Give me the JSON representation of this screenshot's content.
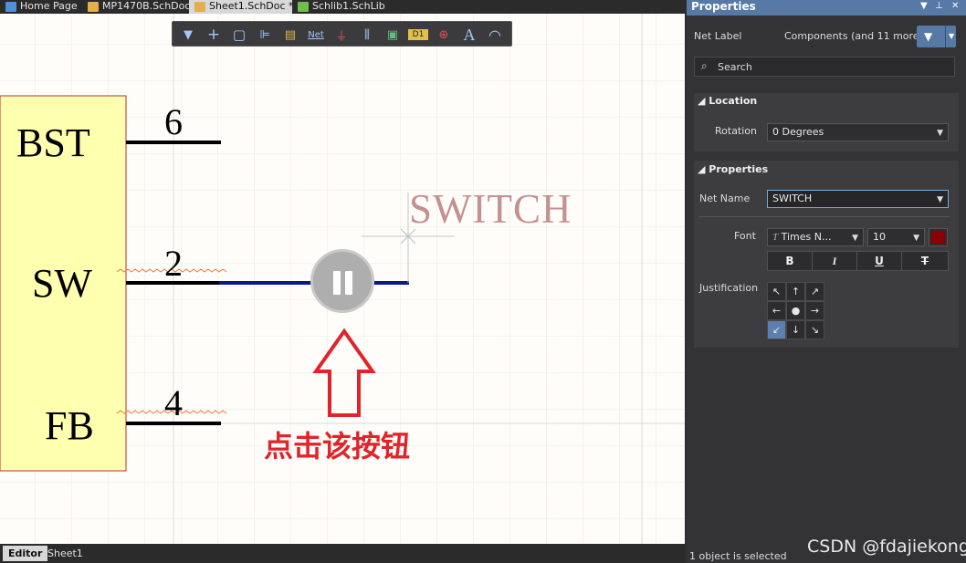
{
  "tabs": [
    {
      "label": "Home Page",
      "icon": "home-icon",
      "color": "#4f8fe0"
    },
    {
      "label": "MP1470B.SchDoc",
      "icon": "schematic-doc-icon",
      "color": "#e3b04a"
    },
    {
      "label": "Sheet1.SchDoc *",
      "icon": "schematic-doc-icon",
      "color": "#e3b04a"
    },
    {
      "label": "Schlib1.SchLib",
      "icon": "schlib-icon",
      "color": "#6fbf4a"
    }
  ],
  "toolbar": {
    "tools": [
      {
        "name": "filter-tool-icon",
        "glyph": "▼"
      },
      {
        "name": "crosshair-tool-icon",
        "glyph": "+"
      },
      {
        "name": "select-box-tool-icon",
        "glyph": "▢"
      },
      {
        "name": "align-tool-icon",
        "glyph": "⊫"
      },
      {
        "name": "component-tool-icon",
        "glyph": "▤"
      },
      {
        "name": "netlabel-tool-icon",
        "glyph": "Net"
      },
      {
        "name": "ground-tool-icon",
        "glyph": "⏚"
      },
      {
        "name": "bus-tool-icon",
        "glyph": "⫼"
      },
      {
        "name": "harness-tool-icon",
        "glyph": "▣"
      },
      {
        "name": "port-tool-icon",
        "glyph": "D1"
      },
      {
        "name": "probe-tool-icon",
        "glyph": "⊕"
      },
      {
        "name": "text-tool-icon",
        "glyph": "A"
      },
      {
        "name": "arc-tool-icon",
        "glyph": "◠"
      }
    ]
  },
  "schematic": {
    "pins": [
      {
        "name": "BST",
        "number": "6"
      },
      {
        "name": "SW",
        "number": "2"
      },
      {
        "name": "FB",
        "number": "4"
      }
    ],
    "net_label": "SWITCH",
    "hint": "点击该按钮"
  },
  "bottom_tabs": [
    "Editor",
    "Sheet1"
  ],
  "panel": {
    "title": "Properties",
    "kind": "Net Label",
    "scope": "Components (and 11 more)",
    "search_placeholder": "Search",
    "location_title": "Location",
    "rotation_label": "Rotation",
    "rotation_value": "0 Degrees",
    "properties_title": "Properties",
    "net_name_label": "Net Name",
    "net_name_value": "SWITCH",
    "font_label": "Font",
    "font_name": "Times N...",
    "font_size": "10",
    "font_color": "#8b0000",
    "style_buttons": [
      "B",
      "I",
      "U",
      "T"
    ],
    "justification_label": "Justification",
    "justification": [
      "↖",
      "↑",
      "↗",
      "←",
      "●",
      "→",
      "↙",
      "↓",
      "↘"
    ],
    "status": "1 object is selected"
  },
  "watermark": "CSDN @fdajiekong"
}
